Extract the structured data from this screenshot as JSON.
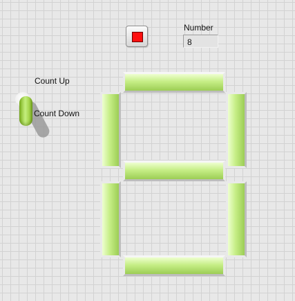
{
  "stop_button": {
    "color": "#ff1010"
  },
  "number_indicator": {
    "label": "Number",
    "value": "8"
  },
  "direction_switch": {
    "up_label": "Count Up",
    "down_label": "Count Down",
    "position": "down",
    "color": "#a5d54c"
  },
  "display": {
    "digit": 8,
    "color": "#c6ee86",
    "segments": [
      {
        "id": "a",
        "lit": true
      },
      {
        "id": "b",
        "lit": true
      },
      {
        "id": "c",
        "lit": true
      },
      {
        "id": "d",
        "lit": true
      },
      {
        "id": "e",
        "lit": true
      },
      {
        "id": "f",
        "lit": true
      },
      {
        "id": "g",
        "lit": true
      }
    ]
  }
}
